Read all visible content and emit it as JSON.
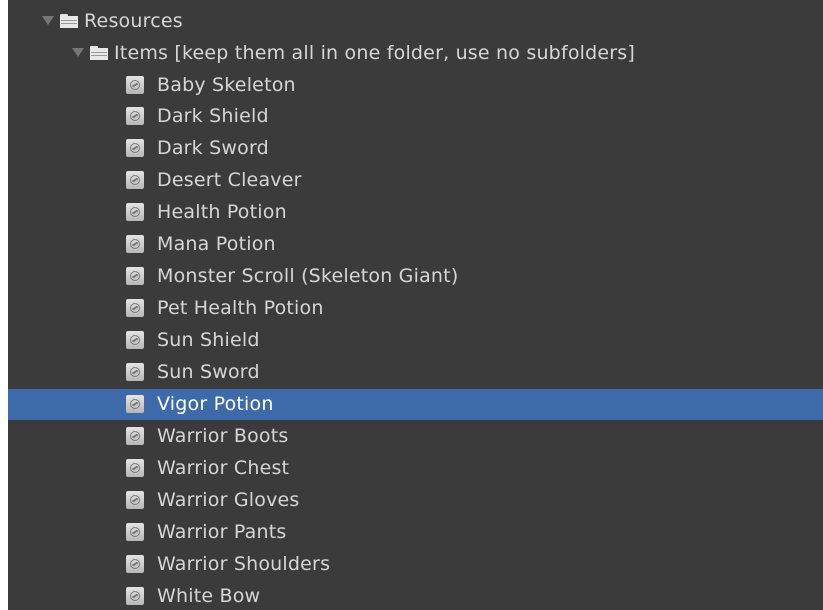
{
  "tree": {
    "root": {
      "label": "Resources",
      "expanded": true,
      "icon": "folder-icon"
    },
    "subfolder": {
      "label": "Items [keep them all in one folder, use no subfolders]",
      "expanded": true,
      "icon": "folder-icon"
    },
    "items": [
      {
        "label": "Baby Skeleton"
      },
      {
        "label": "Dark Shield"
      },
      {
        "label": "Dark Sword"
      },
      {
        "label": "Desert Cleaver"
      },
      {
        "label": "Health Potion"
      },
      {
        "label": "Mana Potion"
      },
      {
        "label": "Monster Scroll (Skeleton Giant)"
      },
      {
        "label": "Pet Health Potion"
      },
      {
        "label": "Sun Shield"
      },
      {
        "label": "Sun Sword"
      },
      {
        "label": "Vigor Potion",
        "selected": true
      },
      {
        "label": "Warrior Boots"
      },
      {
        "label": "Warrior Chest"
      },
      {
        "label": "Warrior Gloves"
      },
      {
        "label": "Warrior Pants"
      },
      {
        "label": "Warrior Shoulders"
      },
      {
        "label": "White Bow"
      }
    ],
    "item_icon": "scriptable-object-asset-icon"
  },
  "colors": {
    "panel_background": "#3b3b3b",
    "selection": "#3d6aa9",
    "text": "#d6d6d6",
    "selected_text": "#ffffff"
  }
}
